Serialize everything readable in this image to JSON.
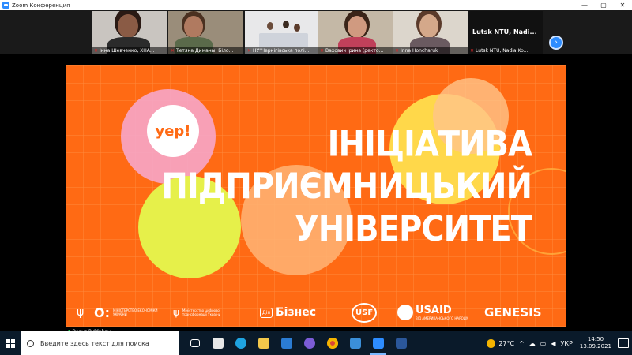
{
  "window": {
    "title": "Zoom Конференция",
    "controls": [
      "—",
      "▢",
      "✕"
    ]
  },
  "gallery": {
    "participants": [
      {
        "name": "Інна Шевченко, ХНА..."
      },
      {
        "name": "Тетяна Диманы, Біло..."
      },
      {
        "name": "НУ\"Чернігівська полі..."
      },
      {
        "name": "Вахович Ірина (ректо..."
      },
      {
        "name": "Inna Honcharuk"
      },
      {
        "name": "Lutsk NTU, Nadia Ko...",
        "big_label": "Lutsk NTU, Nadi..."
      }
    ],
    "next_page_icon": "chevron-right-icon"
  },
  "slide": {
    "badge": "yep!",
    "headline_lines": [
      "ІНІЦІАТИВА",
      "ПІДПРИЄМНИЦЬКИЙ",
      "УНІВЕРСИТЕТ"
    ],
    "logos": {
      "ministry_economy": "МІНІСТЕРСТВО ЕКОНОМІКИ УКРАЇНИ",
      "ministry_digital": "Міністерство цифрової трансформації України",
      "diia_business": "Бізнес",
      "diia_mark": "Дія",
      "usf": "USF",
      "usaid": "USAID",
      "usaid_sub": "ВІД АМЕРИКАНСЬКОГО НАРОДУ",
      "genesis": "GENESIS"
    },
    "colors": {
      "background": "#ff6a14",
      "text": "#ffffff"
    }
  },
  "presenter": {
    "name": "Denys Piddubnyi"
  },
  "taskbar": {
    "search_placeholder": "Введите здесь текст для поиска",
    "weather": "27°C",
    "language": "УКР",
    "time": "14:50",
    "date": "13.09.2021"
  }
}
